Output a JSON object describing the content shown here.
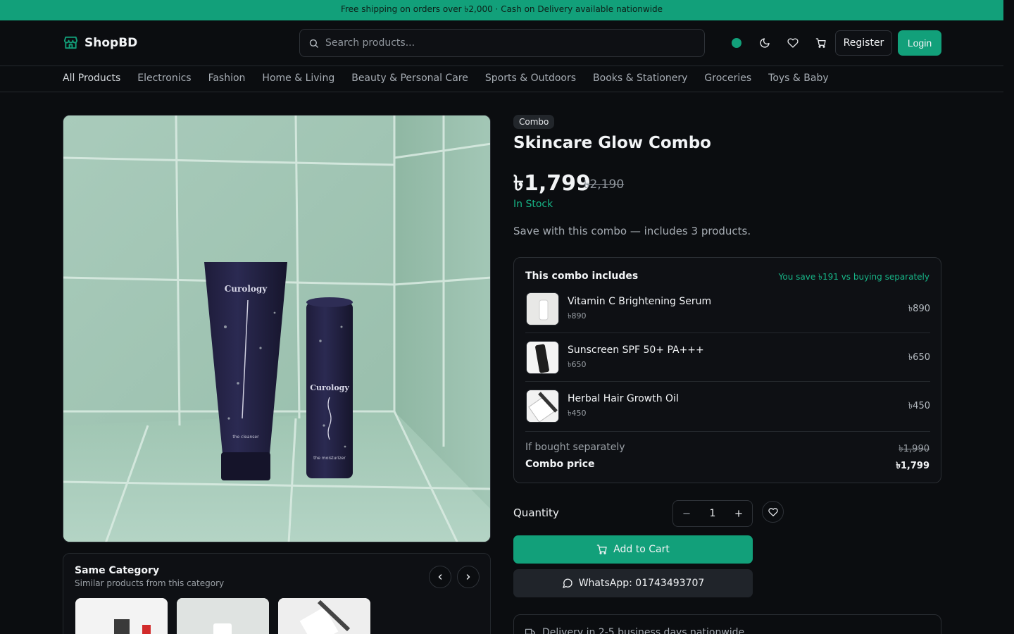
{
  "announcement": "Free shipping on orders over ৳2,000 · Cash on Delivery available nationwide",
  "header": {
    "brand": "ShopBD",
    "search_placeholder": "Search products...",
    "register_label": "Register",
    "login_label": "Login",
    "icons": [
      "status-dot",
      "moon-icon",
      "heart-icon",
      "cart-icon"
    ]
  },
  "categories": [
    "All Products",
    "Electronics",
    "Fashion",
    "Home & Living",
    "Beauty & Personal Care",
    "Sports & Outdoors",
    "Books & Stationery",
    "Groceries",
    "Toys & Baby"
  ],
  "product": {
    "badge": "Combo",
    "title": "Skincare Glow Combo",
    "price": "৳1,799",
    "old_price": "৳2,190",
    "stock": "In Stock",
    "description": "Save with this combo — includes 3 products."
  },
  "combo": {
    "heading": "This combo includes",
    "savings": "You save ৳191 vs buying separately",
    "items": [
      {
        "name": "Vitamin C Brightening Serum",
        "sub_price": "৳890",
        "price": "৳890"
      },
      {
        "name": "Sunscreen SPF 50+ PA+++",
        "sub_price": "৳650",
        "price": "৳650"
      },
      {
        "name": "Herbal Hair Growth Oil",
        "sub_price": "৳450",
        "price": "৳450"
      }
    ],
    "separately_label": "If bought separately",
    "separately_value": "৳1,990",
    "combo_label": "Combo price",
    "combo_value": "৳1,799"
  },
  "purchase": {
    "quantity_label": "Quantity",
    "quantity": "1",
    "add_to_cart": "Add to Cart",
    "whatsapp": "WhatsApp: 01743493707",
    "delivery": "Delivery in 2-5 business days nationwide"
  },
  "same_category": {
    "title": "Same Category",
    "subtitle": "Similar products from this category"
  },
  "colors": {
    "accent": "#12a07a",
    "background": "#0b0d10",
    "success_text": "#17b587"
  }
}
